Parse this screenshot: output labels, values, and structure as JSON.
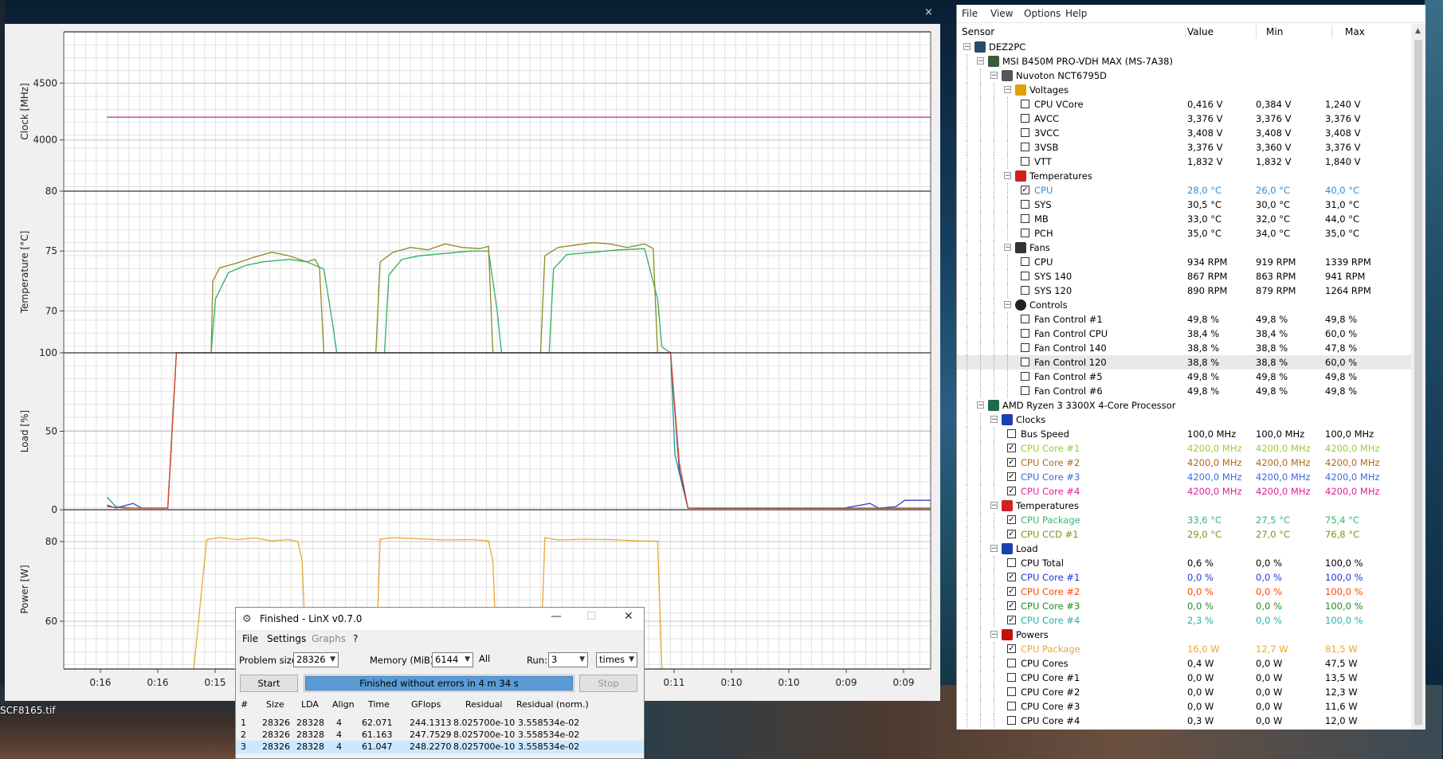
{
  "desktop": {
    "file_label": "SCF8165.tif"
  },
  "chart_window": {
    "close_glyph": "×"
  },
  "chart_data": [
    {
      "type": "line",
      "ylabel": "Clock [MHz]",
      "yticks": [
        4000,
        4500
      ],
      "ylim": [
        3550,
        4950
      ],
      "grid": true,
      "series": [
        {
          "color": "#c0209a",
          "x": [
            0.05,
            1.0
          ],
          "values": [
            4200,
            4200
          ]
        }
      ]
    },
    {
      "type": "line",
      "ylabel": "Temperature [°C]",
      "yticks": [
        70,
        75,
        80
      ],
      "ylim": [
        66.5,
        80
      ],
      "grid": true,
      "series": [
        {
          "color": "#2fae62",
          "x": [
            0.17,
            0.175,
            0.19,
            0.21,
            0.23,
            0.26,
            0.28,
            0.3,
            0.31,
            0.315,
            0.37,
            0.375,
            0.39,
            0.41,
            0.44,
            0.47,
            0.49,
            0.5,
            0.505,
            0.56,
            0.565,
            0.58,
            0.61,
            0.64,
            0.67,
            0.685,
            0.69,
            0.7
          ],
          "values": [
            66.5,
            71,
            73.2,
            73.8,
            74.1,
            74.3,
            74.1,
            73.5,
            69,
            66.5,
            66.5,
            73,
            74.3,
            74.6,
            74.8,
            75.0,
            75.0,
            70,
            66.5,
            66.5,
            73.5,
            74.7,
            74.9,
            75.1,
            75.2,
            71,
            67,
            66.5
          ]
        },
        {
          "color": "#8c8a20",
          "x": [
            0.17,
            0.172,
            0.18,
            0.2,
            0.22,
            0.24,
            0.26,
            0.28,
            0.29,
            0.295,
            0.3,
            0.36,
            0.365,
            0.38,
            0.4,
            0.42,
            0.44,
            0.46,
            0.48,
            0.49,
            0.495,
            0.55,
            0.555,
            0.57,
            0.59,
            0.61,
            0.63,
            0.65,
            0.67,
            0.68,
            0.685
          ],
          "values": [
            66.5,
            72.5,
            73.6,
            74.0,
            74.5,
            74.9,
            74.6,
            74.1,
            74.3,
            73.6,
            66.5,
            66.5,
            74.1,
            74.9,
            75.3,
            75.1,
            75.6,
            75.3,
            75.2,
            75.4,
            66.5,
            66.5,
            74.6,
            75.3,
            75.5,
            75.7,
            75.6,
            75.3,
            75.6,
            75.2,
            66.5
          ]
        }
      ]
    },
    {
      "type": "line",
      "ylabel": "Load [%]",
      "yticks": [
        0,
        50,
        100
      ],
      "ylim": [
        0,
        100
      ],
      "grid": true,
      "series": [
        {
          "color": "#1a9a8a",
          "x": [
            0.05,
            0.06,
            0.08,
            0.11,
            0.12,
            0.13,
            0.7,
            0.705,
            0.72,
            0.73,
            1.0
          ],
          "values": [
            8,
            2,
            1,
            1,
            1,
            100,
            100,
            35,
            1,
            0.8,
            0.8
          ]
        },
        {
          "color": "#3344cc",
          "x": [
            0.05,
            0.06,
            0.08,
            0.09,
            0.11,
            0.12,
            0.13,
            0.7,
            0.71,
            0.72,
            0.9,
            0.93,
            0.94,
            0.96,
            0.97,
            1.0
          ],
          "values": [
            3,
            1,
            4,
            1,
            1,
            1,
            100,
            100,
            25,
            1,
            1,
            4,
            1,
            2,
            6,
            6
          ]
        },
        {
          "color": "#e04a20",
          "x": [
            0.05,
            0.07,
            0.08,
            0.12,
            0.13,
            0.7,
            0.71,
            0.72,
            1.0
          ],
          "values": [
            2,
            1,
            1,
            1,
            100,
            100,
            30,
            1,
            1
          ]
        }
      ]
    },
    {
      "type": "line",
      "ylabel": "Power [W]",
      "yticks": [
        60,
        80
      ],
      "ylim": [
        48,
        88
      ],
      "grid": true,
      "series": [
        {
          "color": "#e8a830",
          "x": [
            0.15,
            0.16,
            0.165,
            0.18,
            0.2,
            0.22,
            0.24,
            0.26,
            0.27,
            0.275,
            0.28,
            0.36,
            0.365,
            0.38,
            0.41,
            0.44,
            0.47,
            0.49,
            0.495,
            0.5,
            0.55,
            0.555,
            0.57,
            0.6,
            0.63,
            0.66,
            0.685,
            0.69
          ],
          "values": [
            48,
            70,
            80.5,
            81.0,
            80.5,
            80.9,
            80.2,
            80.5,
            80.0,
            75,
            48,
            48,
            80.6,
            81.0,
            80.7,
            80.4,
            80.5,
            80.2,
            75,
            48,
            48,
            81.0,
            80.4,
            80.6,
            80.5,
            80.2,
            80.1,
            48
          ]
        }
      ]
    }
  ],
  "x_ticks": [
    "0:16",
    "0:16",
    "0:15",
    "",
    "",
    "",
    "",
    "",
    "",
    "",
    "0:11",
    "0:10",
    "0:10",
    "0:09",
    "0:09"
  ],
  "sensor": {
    "menu": [
      "File",
      "View",
      "Options",
      "Help"
    ],
    "columns": {
      "sensor": "Sensor",
      "value": "Value",
      "min": "Min",
      "max": "Max"
    },
    "rows": [
      {
        "depth": 0,
        "type": "node",
        "icon": "computer-icon",
        "label": "DEZ2PC"
      },
      {
        "depth": 1,
        "type": "node",
        "icon": "motherboard-icon",
        "label": "MSI B450M PRO-VDH MAX (MS-7A38)"
      },
      {
        "depth": 2,
        "type": "node",
        "icon": "chip-icon",
        "label": "Nuvoton NCT6795D"
      },
      {
        "depth": 3,
        "type": "group",
        "icon": "voltage-icon",
        "label": "Voltages"
      },
      {
        "depth": 4,
        "type": "sensor",
        "checked": false,
        "label": "CPU VCore",
        "value": "0,416 V",
        "min": "0,384 V",
        "max": "1,240 V",
        "color": "#000000"
      },
      {
        "depth": 4,
        "type": "sensor",
        "checked": false,
        "label": "AVCC",
        "value": "3,376 V",
        "min": "3,376 V",
        "max": "3,376 V",
        "color": "#000000"
      },
      {
        "depth": 4,
        "type": "sensor",
        "checked": false,
        "label": "3VCC",
        "value": "3,408 V",
        "min": "3,408 V",
        "max": "3,408 V",
        "color": "#000000"
      },
      {
        "depth": 4,
        "type": "sensor",
        "checked": false,
        "label": "3VSB",
        "value": "3,376 V",
        "min": "3,360 V",
        "max": "3,376 V",
        "color": "#000000"
      },
      {
        "depth": 4,
        "type": "sensor",
        "checked": false,
        "label": "VTT",
        "value": "1,832 V",
        "min": "1,832 V",
        "max": "1,840 V",
        "color": "#000000"
      },
      {
        "depth": 3,
        "type": "group",
        "icon": "thermometer-icon",
        "label": "Temperatures"
      },
      {
        "depth": 4,
        "type": "sensor",
        "checked": true,
        "label": "CPU",
        "value": "28,0 °C",
        "min": "26,0 °C",
        "max": "40,0 °C",
        "color": "#2a8fe0"
      },
      {
        "depth": 4,
        "type": "sensor",
        "checked": false,
        "label": "SYS",
        "value": "30,5 °C",
        "min": "30,0 °C",
        "max": "31,0 °C",
        "color": "#000000"
      },
      {
        "depth": 4,
        "type": "sensor",
        "checked": false,
        "label": "MB",
        "value": "33,0 °C",
        "min": "32,0 °C",
        "max": "44,0 °C",
        "color": "#000000"
      },
      {
        "depth": 4,
        "type": "sensor",
        "checked": false,
        "label": "PCH",
        "value": "35,0 °C",
        "min": "34,0 °C",
        "max": "35,0 °C",
        "color": "#000000"
      },
      {
        "depth": 3,
        "type": "group",
        "icon": "fan-icon",
        "label": "Fans"
      },
      {
        "depth": 4,
        "type": "sensor",
        "checked": false,
        "label": "CPU",
        "value": "934 RPM",
        "min": "919 RPM",
        "max": "1339 RPM",
        "color": "#000000"
      },
      {
        "depth": 4,
        "type": "sensor",
        "checked": false,
        "label": "SYS 140",
        "value": "867 RPM",
        "min": "863 RPM",
        "max": "941 RPM",
        "color": "#000000"
      },
      {
        "depth": 4,
        "type": "sensor",
        "checked": false,
        "label": "SYS 120",
        "value": "890 RPM",
        "min": "879 RPM",
        "max": "1264 RPM",
        "color": "#000000"
      },
      {
        "depth": 3,
        "type": "group",
        "icon": "controls-icon",
        "label": "Controls"
      },
      {
        "depth": 4,
        "type": "sensor",
        "checked": false,
        "label": "Fan Control #1",
        "value": "49,8 %",
        "min": "49,8 %",
        "max": "49,8 %",
        "color": "#000000"
      },
      {
        "depth": 4,
        "type": "sensor",
        "checked": false,
        "label": "Fan Control CPU",
        "value": "38,4 %",
        "min": "38,4 %",
        "max": "60,0 %",
        "color": "#000000"
      },
      {
        "depth": 4,
        "type": "sensor",
        "checked": false,
        "label": "Fan Control 140",
        "value": "38,8 %",
        "min": "38,8 %",
        "max": "47,8 %",
        "color": "#000000"
      },
      {
        "depth": 4,
        "type": "sensor",
        "checked": false,
        "label": "Fan Control 120",
        "value": "38,8 %",
        "min": "38,8 %",
        "max": "60,0 %",
        "color": "#000000",
        "highlight": true
      },
      {
        "depth": 4,
        "type": "sensor",
        "checked": false,
        "label": "Fan Control #5",
        "value": "49,8 %",
        "min": "49,8 %",
        "max": "49,8 %",
        "color": "#000000"
      },
      {
        "depth": 4,
        "type": "sensor",
        "checked": false,
        "label": "Fan Control #6",
        "value": "49,8 %",
        "min": "49,8 %",
        "max": "49,8 %",
        "color": "#000000"
      },
      {
        "depth": 1,
        "type": "node",
        "icon": "cpu-icon",
        "label": "AMD Ryzen 3 3300X 4-Core Processor"
      },
      {
        "depth": 2,
        "type": "group",
        "icon": "clock-icon",
        "label": "Clocks"
      },
      {
        "depth": 3,
        "type": "sensor",
        "checked": false,
        "label": "Bus Speed",
        "value": "100,0 MHz",
        "min": "100,0 MHz",
        "max": "100,0 MHz",
        "color": "#000000"
      },
      {
        "depth": 3,
        "type": "sensor",
        "checked": true,
        "label": "CPU Core #1",
        "value": "4200,0 MHz",
        "min": "4200,0 MHz",
        "max": "4200,0 MHz",
        "color": "#9acd32"
      },
      {
        "depth": 3,
        "type": "sensor",
        "checked": true,
        "label": "CPU Core #2",
        "value": "4200,0 MHz",
        "min": "4200,0 MHz",
        "max": "4200,0 MHz",
        "color": "#b5651d"
      },
      {
        "depth": 3,
        "type": "sensor",
        "checked": true,
        "label": "CPU Core #3",
        "value": "4200,0 MHz",
        "min": "4200,0 MHz",
        "max": "4200,0 MHz",
        "color": "#4169e1"
      },
      {
        "depth": 3,
        "type": "sensor",
        "checked": true,
        "label": "CPU Core #4",
        "value": "4200,0 MHz",
        "min": "4200,0 MHz",
        "max": "4200,0 MHz",
        "color": "#e0209a"
      },
      {
        "depth": 2,
        "type": "group",
        "icon": "thermometer-icon",
        "label": "Temperatures"
      },
      {
        "depth": 3,
        "type": "sensor",
        "checked": true,
        "label": "CPU Package",
        "value": "33,6 °C",
        "min": "27,5 °C",
        "max": "75,4 °C",
        "color": "#3cb371"
      },
      {
        "depth": 3,
        "type": "sensor",
        "checked": true,
        "label": "CPU CCD #1",
        "value": "29,0 °C",
        "min": "27,0 °C",
        "max": "76,8 °C",
        "color": "#8c8a20"
      },
      {
        "depth": 2,
        "type": "group",
        "icon": "load-icon",
        "label": "Load"
      },
      {
        "depth": 3,
        "type": "sensor",
        "checked": false,
        "label": "CPU Total",
        "value": "0,6 %",
        "min": "0,0 %",
        "max": "100,0 %",
        "color": "#000000"
      },
      {
        "depth": 3,
        "type": "sensor",
        "checked": true,
        "label": "CPU Core #1",
        "value": "0,0 %",
        "min": "0,0 %",
        "max": "100,0 %",
        "color": "#2233dd"
      },
      {
        "depth": 3,
        "type": "sensor",
        "checked": true,
        "label": "CPU Core #2",
        "value": "0,0 %",
        "min": "0,0 %",
        "max": "100,0 %",
        "color": "#ff4500"
      },
      {
        "depth": 3,
        "type": "sensor",
        "checked": true,
        "label": "CPU Core #3",
        "value": "0,0 %",
        "min": "0,0 %",
        "max": "100,0 %",
        "color": "#228b22"
      },
      {
        "depth": 3,
        "type": "sensor",
        "checked": true,
        "label": "CPU Core #4",
        "value": "2,3 %",
        "min": "0,0 %",
        "max": "100,0 %",
        "color": "#20b2aa"
      },
      {
        "depth": 2,
        "type": "group",
        "icon": "power-icon",
        "label": "Powers"
      },
      {
        "depth": 3,
        "type": "sensor",
        "checked": true,
        "label": "CPU Package",
        "value": "16,0 W",
        "min": "12,7 W",
        "max": "81,5 W",
        "color": "#e8a830"
      },
      {
        "depth": 3,
        "type": "sensor",
        "checked": false,
        "label": "CPU Cores",
        "value": "0,4 W",
        "min": "0,0 W",
        "max": "47,5 W",
        "color": "#000000"
      },
      {
        "depth": 3,
        "type": "sensor",
        "checked": false,
        "label": "CPU Core #1",
        "value": "0,0 W",
        "min": "0,0 W",
        "max": "13,5 W",
        "color": "#000000"
      },
      {
        "depth": 3,
        "type": "sensor",
        "checked": false,
        "label": "CPU Core #2",
        "value": "0,0 W",
        "min": "0,0 W",
        "max": "12,3 W",
        "color": "#000000"
      },
      {
        "depth": 3,
        "type": "sensor",
        "checked": false,
        "label": "CPU Core #3",
        "value": "0,0 W",
        "min": "0,0 W",
        "max": "11,6 W",
        "color": "#000000"
      },
      {
        "depth": 3,
        "type": "sensor",
        "checked": false,
        "label": "CPU Core #4",
        "value": "0,3 W",
        "min": "0,0 W",
        "max": "12,0 W",
        "color": "#000000"
      }
    ]
  },
  "linx": {
    "title": "Finished - LinX v0.7.0",
    "menu": [
      "File",
      "Settings",
      "Graphs",
      "?"
    ],
    "problem_size_label": "Problem size:",
    "problem_size": "28326",
    "memory_label": "Memory (MiB):",
    "memory": "6144",
    "all_label": "All",
    "run_label": "Run:",
    "run": "3",
    "times": "times",
    "start": "Start",
    "stop": "Stop",
    "progress_text": "Finished without errors in 4 m 34 s",
    "progress_fraction": 1.0,
    "columns": [
      "#",
      "Size",
      "LDA",
      "Align",
      "Time",
      "GFlops",
      "Residual",
      "Residual (norm.)"
    ],
    "rows": [
      [
        "1",
        "28326",
        "28328",
        "4",
        "62.071",
        "244.1313",
        "8.025700e-10",
        "3.558534e-02"
      ],
      [
        "2",
        "28326",
        "28328",
        "4",
        "61.163",
        "247.7529",
        "8.025700e-10",
        "3.558534e-02"
      ],
      [
        "3",
        "28326",
        "28328",
        "4",
        "61.047",
        "248.2270",
        "8.025700e-10",
        "3.558534e-02"
      ]
    ],
    "selected_row": 2
  }
}
